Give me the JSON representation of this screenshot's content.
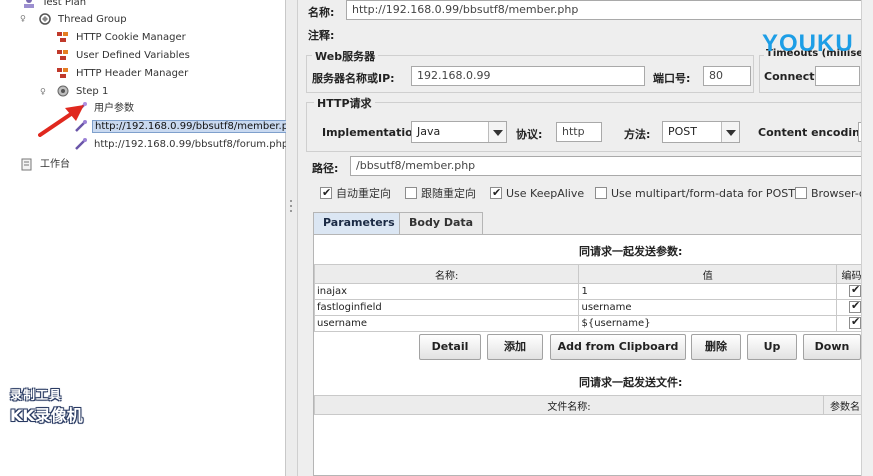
{
  "tree": {
    "test_plan": "Test Plan",
    "thread_group": "Thread Group",
    "cookie_manager": "HTTP Cookie Manager",
    "user_vars": "User Defined Variables",
    "header_manager": "HTTP Header Manager",
    "step": "Step 1",
    "user_params": "用户参数",
    "sampler_member": "http://192.168.0.99/bbsutf8/member.php",
    "sampler_forum": "http://192.168.0.99/bbsutf8/forum.php",
    "workbench": "工作台"
  },
  "panel": {
    "name_label": "名称:",
    "name_value": "http://192.168.0.99/bbsutf8/member.php",
    "comment_label": "注释:",
    "web_server_title": "Web服务器",
    "server_label": "服务器名称或IP:",
    "server_value": "192.168.0.99",
    "port_label": "端口号:",
    "port_value": "80",
    "timeouts_title": "Timeouts (millisec",
    "connect_label": "Connect:",
    "http_request_title": "HTTP请求",
    "impl_label": "Implementation:",
    "impl_value": "Java",
    "protocol_label": "协议:",
    "protocol_value": "http",
    "method_label": "方法:",
    "method_value": "POST",
    "encoding_label": "Content encoding:",
    "path_label": "路径:",
    "path_value": "/bbsutf8/member.php",
    "checkboxes": [
      {
        "label": "自动重定向",
        "checked": true
      },
      {
        "label": "跟随重定向",
        "checked": false
      },
      {
        "label": "Use KeepAlive",
        "checked": true
      },
      {
        "label": "Use multipart/form-data for POST",
        "checked": false
      },
      {
        "label": "Browser-c",
        "checked": false
      }
    ],
    "tabs": [
      "Parameters",
      "Body Data"
    ],
    "params_caption": "同请求一起发送参数:",
    "params_headers": [
      "名称:",
      "值",
      "编码"
    ],
    "params_rows": [
      {
        "name": "inajax",
        "value": "1"
      },
      {
        "name": "fastloginfield",
        "value": "username"
      },
      {
        "name": "username",
        "value": "${username}"
      }
    ],
    "buttons": {
      "detail": "Detail",
      "add": "添加",
      "clipboard": "Add from Clipboard",
      "delete": "删除",
      "up": "Up",
      "down": "Down"
    },
    "files_caption": "同请求一起发送文件:",
    "files_headers": [
      "文件名称:",
      "参数名"
    ]
  },
  "watermarks": {
    "youku": "YOUKU",
    "kk_line1": "录制工具",
    "kk_line2": "KK录像机"
  },
  "colors": {
    "selection_bg": "#c9d9f0",
    "tab_active": "#dbe6f3",
    "youku_blue": "#1d9ee6",
    "youku_red": "#e8343a",
    "arrow_red": "#e0281e"
  }
}
